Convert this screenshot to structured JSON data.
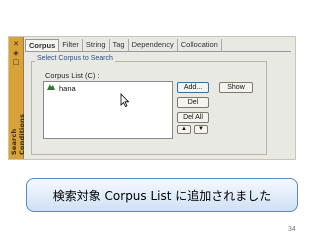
{
  "side_panel": {
    "title": "Search Conditions",
    "icons": [
      "pin-icon",
      "close-icon",
      "restore-icon"
    ]
  },
  "tabs": [
    {
      "label": "Corpus",
      "active": true
    },
    {
      "label": "Filter",
      "active": false
    },
    {
      "label": "String",
      "active": false
    },
    {
      "label": "Tag",
      "active": false
    },
    {
      "label": "Dependency",
      "active": false
    },
    {
      "label": "Collocation",
      "active": false
    }
  ],
  "group": {
    "title": "Select Corpus to Search",
    "list_label": "Corpus List (C) :",
    "items": [
      {
        "name": "hana",
        "icon": "corpus-icon"
      }
    ]
  },
  "buttons": {
    "add": "Add...",
    "show": "Show",
    "del": "Del",
    "del_all": "Del All",
    "up": "▲",
    "down": "▼"
  },
  "caption": "検索対象 Corpus List に追加されました",
  "page_number": "34",
  "colors": {
    "side_panel": "#d8a23a",
    "group_title": "#2b4e8c",
    "caption_border": "#5a8ab9"
  }
}
